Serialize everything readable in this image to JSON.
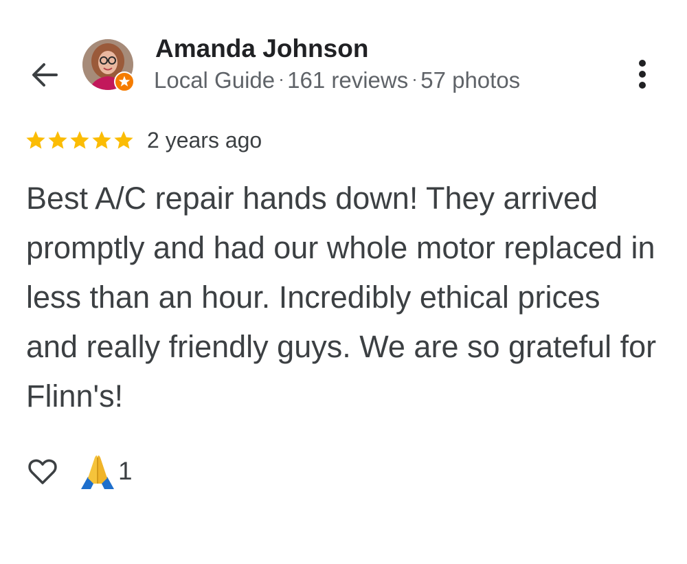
{
  "header": {
    "user_name": "Amanda Johnson",
    "meta": {
      "badge": "Local Guide",
      "reviews": "161 reviews",
      "photos": "57 photos"
    },
    "icons": {
      "back": "arrow-back-icon",
      "more": "more-vert-icon",
      "guide_badge": "local-guide-star-icon"
    }
  },
  "review": {
    "rating": 5,
    "rating_max": 5,
    "timestamp": "2 years ago",
    "text": "Best A/C repair hands down! They arrived promptly and had our whole motor replaced in less than an hour. Incredibly ethical prices and really friendly guys. We are so grateful for Flinn's!"
  },
  "actions": {
    "like_icon": "heart-outline-icon",
    "reaction_icon": "folded-hands-icon",
    "reaction_count": "1"
  },
  "colors": {
    "star": "#fbbc04",
    "badge": "#f57c00",
    "text_primary": "#202124",
    "text_secondary": "#5f6368",
    "text_body": "#3c4043"
  }
}
